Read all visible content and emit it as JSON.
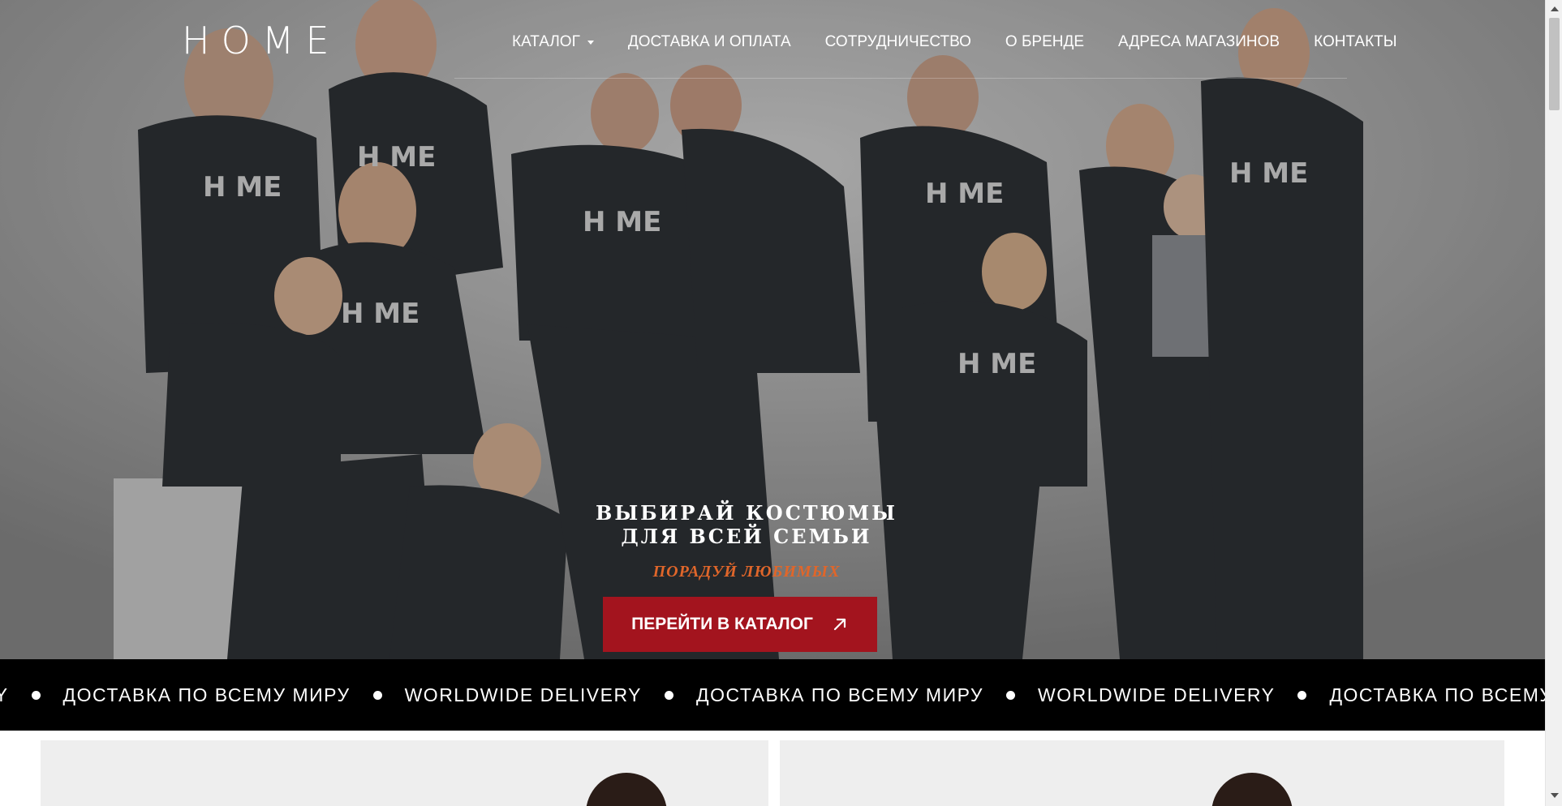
{
  "brand": {
    "logo_text": "HOME"
  },
  "nav": {
    "items": [
      {
        "label": "КАТАЛОГ"
      },
      {
        "label": "ДОСТАВКА И ОПЛАТА"
      },
      {
        "label": "СОТРУДНИЧЕСТВО"
      },
      {
        "label": "О БРЕНДЕ"
      },
      {
        "label": "АДРЕСА МАГАЗИНОВ"
      },
      {
        "label": "КОНТАКТЫ"
      }
    ]
  },
  "hero": {
    "title_line1": "ВЫБИРАЙ КОСТЮМЫ",
    "title_line2": "ДЛЯ ВСЕЙ СЕМЬИ",
    "subtitle": "ПОРАДУЙ ЛЮБИМЫХ",
    "cta_label": "ПЕРЕЙТИ В КАТАЛОГ",
    "cta_icon": "arrow-up-right-icon",
    "accent_color": "#e0662a",
    "button_color": "#a3141e"
  },
  "marquee": {
    "items": [
      "RY",
      "ДОСТАВКА ПО ВСЕМУ МИРУ",
      "WORLDWIDE DELIVERY",
      "ДОСТАВКА ПО ВСЕМУ МИРУ",
      "WORLDWIDE DELIVERY",
      "ДОСТАВКА ПО ВСЕМУ М"
    ],
    "background": "#000000"
  }
}
